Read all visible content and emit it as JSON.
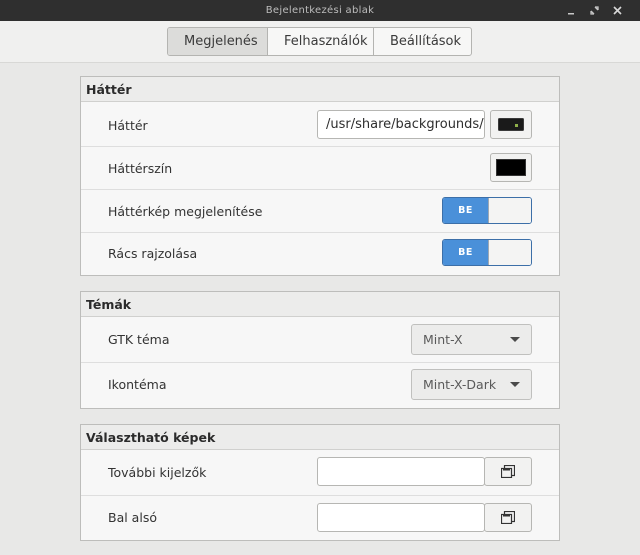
{
  "window": {
    "title": "Bejelentkezési ablak"
  },
  "tabs": [
    {
      "label": "Megjelenés",
      "active": true
    },
    {
      "label": "Felhasználók",
      "active": false
    },
    {
      "label": "Beállítások",
      "active": false
    }
  ],
  "background_section": {
    "title": "Háttér",
    "background_label": "Háttér",
    "background_path": "/usr/share/backgrounds/linuxmint/default_background.jpg",
    "background_color_label": "Háttérszín",
    "background_color_value": "#000000",
    "show_image_label": "Háttérkép megjelenítése",
    "show_image_switch": "BE",
    "draw_grid_label": "Rács rajzolása",
    "draw_grid_switch": "BE"
  },
  "themes_section": {
    "title": "Témák",
    "gtk_theme_label": "GTK téma",
    "gtk_theme_value": "Mint-X",
    "icon_theme_label": "Ikontéma",
    "icon_theme_value": "Mint-X-Dark"
  },
  "images_section": {
    "title": "Választható képek",
    "other_monitors_label": "További kijelzők",
    "other_monitors_value": "",
    "bottom_left_label": "Bal alsó",
    "bottom_left_value": ""
  },
  "colors": {
    "switch_on": "#4a90d9",
    "titlebar": "#2f2f2f"
  }
}
